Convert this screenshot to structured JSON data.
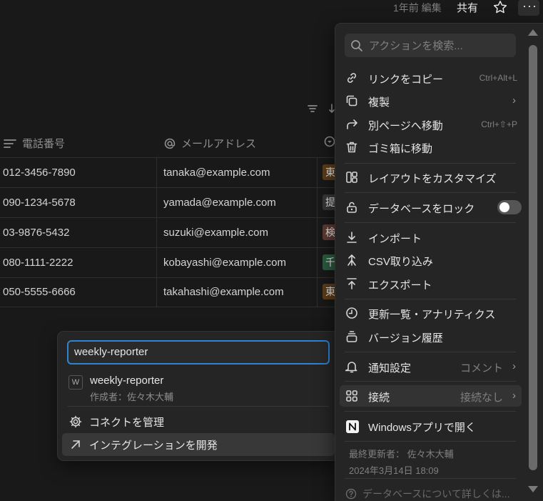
{
  "topbar": {
    "edited": "1年前 編集",
    "share": "共有",
    "star_icon": "star-icon",
    "more_icon": "more-horizontal-icon",
    "more_glyph": "···"
  },
  "table": {
    "columns": [
      {
        "icon": "text-lines-icon",
        "label": "電話番号"
      },
      {
        "icon": "at-sign-icon",
        "label": "メールアドレス"
      },
      {
        "icon": "status-icon",
        "label": ""
      }
    ],
    "rows": [
      {
        "phone": "012-3456-7890",
        "email": "tanaka@example.com",
        "tag": "東",
        "tag_color": "#5a3d1c"
      },
      {
        "phone": "090-1234-5678",
        "email": "yamada@example.com",
        "tag": "提",
        "tag_color": "#373737"
      },
      {
        "phone": "03-9876-5432",
        "email": "suzuki@example.com",
        "tag": "検",
        "tag_color": "#5c3a34"
      },
      {
        "phone": "080-1111-2222",
        "email": "kobayashi@example.com",
        "tag": "千",
        "tag_color": "#2b5a3f"
      },
      {
        "phone": "050-5555-6666",
        "email": "takahashi@example.com",
        "tag": "東",
        "tag_color": "#5a3d1c"
      }
    ]
  },
  "connect_popup": {
    "search_value": "weekly-reporter",
    "result": {
      "icon_letter": "W",
      "name": "weekly-reporter",
      "author": "作成者：佐々木大輔"
    },
    "manage_label": "コネクトを管理",
    "develop_label": "インテグレーションを開発"
  },
  "menu": {
    "search_placeholder": "アクションを検索...",
    "items": {
      "copy_link": {
        "label": "リンクをコピー",
        "shortcut": "Ctrl+Alt+L"
      },
      "duplicate": {
        "label": "複製"
      },
      "move": {
        "label": "別ページへ移動",
        "shortcut": "Ctrl+⇧+P"
      },
      "trash": {
        "label": "ゴミ箱に移動"
      },
      "layout": {
        "label": "レイアウトをカスタマイズ"
      },
      "lock": {
        "label": "データベースをロック",
        "toggle": false
      },
      "import": {
        "label": "インポート"
      },
      "csv": {
        "label": "CSV取り込み"
      },
      "export": {
        "label": "エクスポート"
      },
      "analytics": {
        "label": "更新一覧・アナリティクス"
      },
      "history": {
        "label": "バージョン履歴"
      },
      "notify": {
        "label": "通知設定",
        "value": "コメント"
      },
      "connections": {
        "label": "接続",
        "value": "接続なし"
      },
      "open_app": {
        "label": "Windowsアプリで開く"
      }
    },
    "last_editor": "最終更新者： 佐々木大輔",
    "last_edited": "2024年3月14日 18:09",
    "help": "データベースについて詳しくは..."
  }
}
